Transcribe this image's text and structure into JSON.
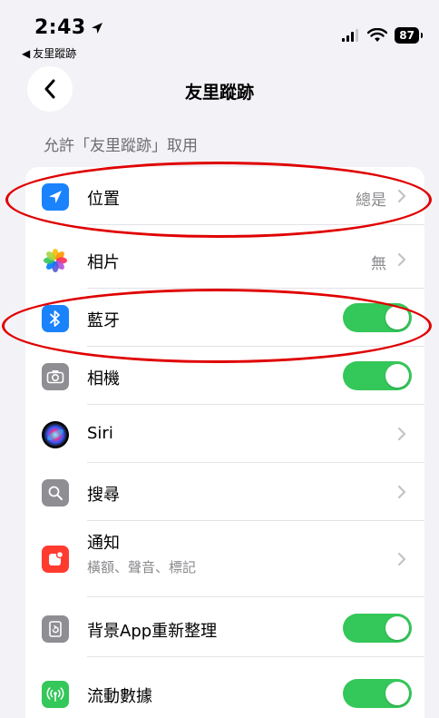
{
  "status_bar": {
    "time": "2:43",
    "back_app": "友里蹤跡",
    "battery": "87",
    "icons": [
      "location-arrow-icon",
      "signal-icon",
      "wifi-icon",
      "battery-icon"
    ]
  },
  "nav": {
    "title": "友里蹤跡"
  },
  "section": {
    "header": "允許「友里蹤跡」取用"
  },
  "rows": [
    {
      "label": "位置",
      "value": "總是",
      "control": "chevron",
      "icon": "location-icon",
      "icon_color": "#1a82fb"
    },
    {
      "label": "相片",
      "value": "無",
      "control": "chevron",
      "icon": "photos-icon"
    },
    {
      "label": "藍牙",
      "control": "toggle",
      "on": true,
      "icon": "bluetooth-icon",
      "icon_color": "#1a82fb"
    },
    {
      "label": "相機",
      "control": "toggle",
      "on": true,
      "icon": "camera-icon",
      "icon_color": "#8e8e93"
    },
    {
      "label": "Siri",
      "control": "chevron",
      "icon": "siri-icon"
    },
    {
      "label": "搜尋",
      "control": "chevron",
      "icon": "search-icon",
      "icon_color": "#8e8e93"
    },
    {
      "label": "通知",
      "sublabel": "橫額、聲音、標記",
      "control": "chevron",
      "icon": "notification-icon",
      "icon_color": "#ff3b30"
    },
    {
      "label": "背景App重新整理",
      "control": "toggle",
      "on": true,
      "icon": "background-refresh-icon",
      "icon_color": "#8e8e93"
    },
    {
      "label": "流動數據",
      "control": "toggle",
      "on": true,
      "icon": "cellular-data-icon",
      "icon_color": "#34c759"
    }
  ],
  "colors": {
    "toggle_on": "#34c759",
    "annotation": "#e00000",
    "background": "#f2f2f7"
  }
}
